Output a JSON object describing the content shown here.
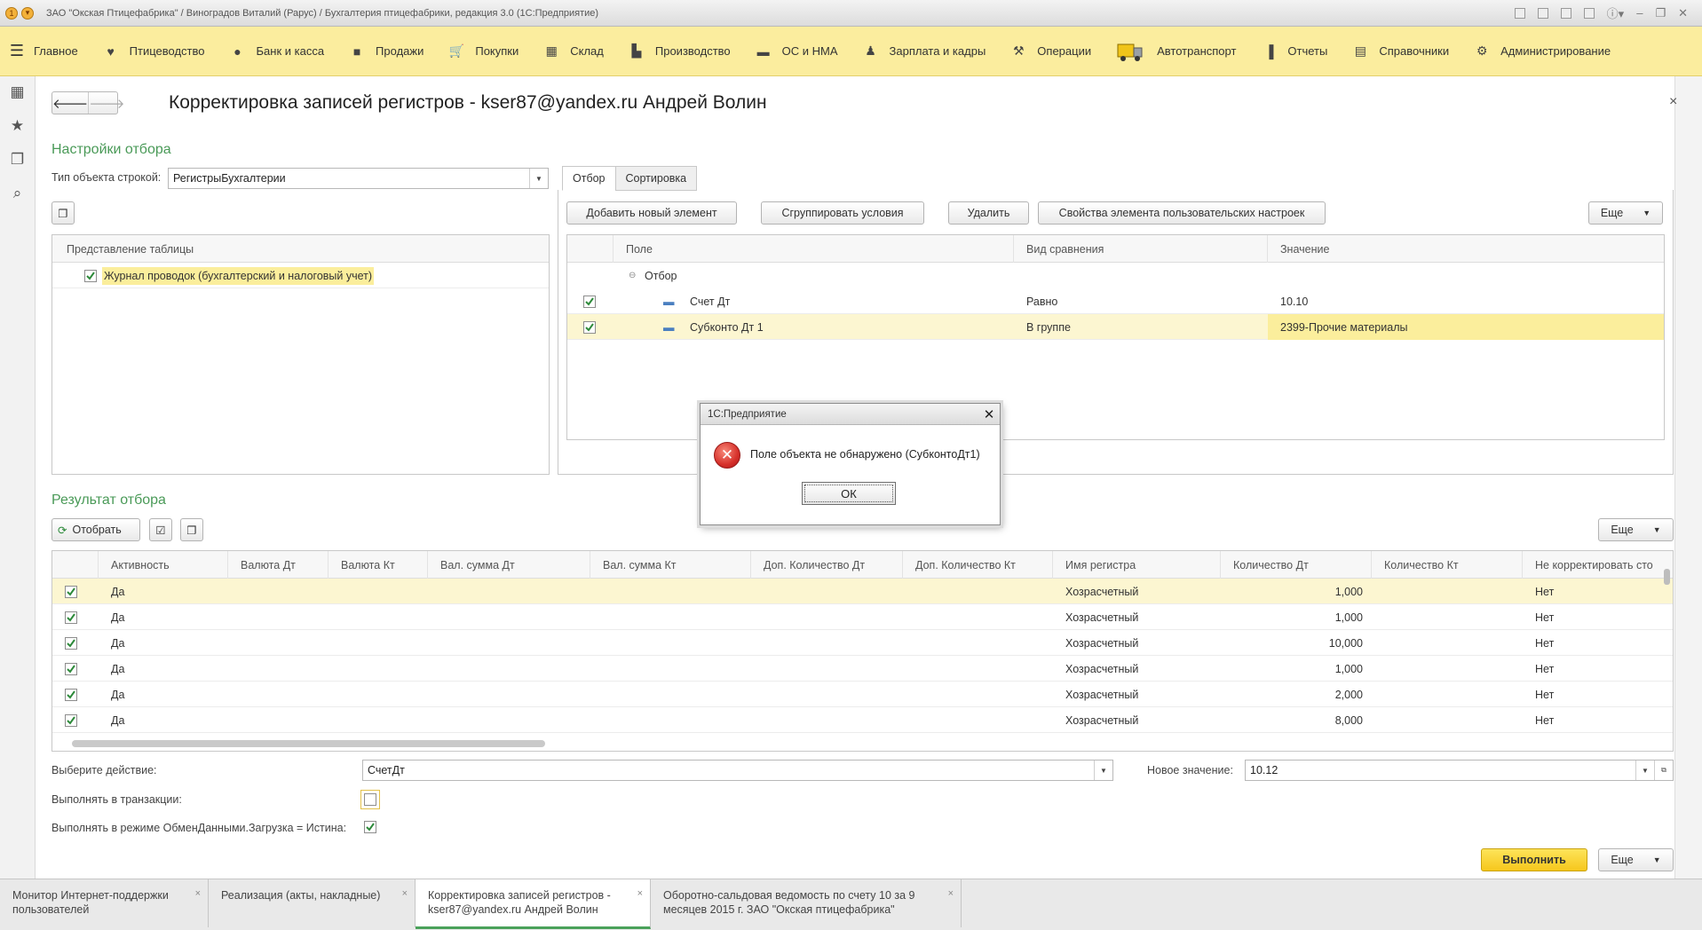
{
  "window": {
    "title": "ЗАО \"Окская Птицефабрика\" / Виноградов Виталий (Рарус) / Бухгалтерия птицефабрики, редакция 3.0  (1С:Предприятие)"
  },
  "menu": [
    {
      "label": "Главное",
      "icon": "burger-icon"
    },
    {
      "label": "Птицеводство",
      "icon": "bird-icon"
    },
    {
      "label": "Банк и касса",
      "icon": "coin-icon"
    },
    {
      "label": "Продажи",
      "icon": "bag-icon"
    },
    {
      "label": "Покупки",
      "icon": "cart-icon"
    },
    {
      "label": "Склад",
      "icon": "grid-icon"
    },
    {
      "label": "Производство",
      "icon": "factory-icon"
    },
    {
      "label": "ОС и НМА",
      "icon": "truck-small-icon"
    },
    {
      "label": "Зарплата и кадры",
      "icon": "person-icon"
    },
    {
      "label": "Операции",
      "icon": "operations-icon"
    },
    {
      "label": "Автотранспорт",
      "icon": "truck-icon"
    },
    {
      "label": "Отчеты",
      "icon": "chart-icon"
    },
    {
      "label": "Справочники",
      "icon": "book-icon"
    },
    {
      "label": "Администрирование",
      "icon": "gear-icon"
    }
  ],
  "form": {
    "title": "Корректировка записей регистров - kser87@yandex.ru Андрей Волин",
    "close": "×"
  },
  "filter_settings": {
    "section_title": "Настройки отбора",
    "object_type_label": "Тип объекта строкой:",
    "object_type_value": "РегистрыБухгалтерии",
    "table_header": "Представление таблицы",
    "table_rows": [
      {
        "checked": true,
        "label": "Журнал проводок (бухгалтерский и налоговый учет)"
      }
    ]
  },
  "tabs": [
    {
      "label": "Отбор",
      "active": true
    },
    {
      "label": "Сортировка",
      "active": false
    }
  ],
  "filter_toolbar": {
    "add": "Добавить новый элемент",
    "group": "Сгруппировать условия",
    "delete": "Удалить",
    "properties": "Свойства элемента пользовательских настроек",
    "more": "Еще"
  },
  "filter_table": {
    "columns": [
      "Поле",
      "Вид сравнения",
      "Значение"
    ],
    "group_label": "Отбор",
    "rows": [
      {
        "checked": true,
        "field": "Счет Дт",
        "comparison": "Равно",
        "value": "10.10"
      },
      {
        "checked": true,
        "field": "Субконто Дт 1",
        "comparison": "В группе",
        "value": "2399-Прочие материалы"
      }
    ]
  },
  "dialog": {
    "title": "1С:Предприятие",
    "message": "Поле объекта не обнаружено (СубконтоДт1)",
    "ok": "ОК"
  },
  "result": {
    "section_title": "Результат отбора",
    "select_button": "Отобрать",
    "more": "Еще",
    "columns": [
      "Активность",
      "Валюта Дт",
      "Валюта Кт",
      "Вал. сумма Дт",
      "Вал. сумма Кт",
      "Доп. Количество Дт",
      "Доп. Количество Кт",
      "Имя регистра",
      "Количество Дт",
      "Количество Кт",
      "Не корректировать сто"
    ],
    "rows": [
      {
        "checked": true,
        "active": "Да",
        "register": "Хозрасчетный",
        "qty_dt": "1,000",
        "no_adjust": "Нет"
      },
      {
        "checked": true,
        "active": "Да",
        "register": "Хозрасчетный",
        "qty_dt": "1,000",
        "no_adjust": "Нет"
      },
      {
        "checked": true,
        "active": "Да",
        "register": "Хозрасчетный",
        "qty_dt": "10,000",
        "no_adjust": "Нет"
      },
      {
        "checked": true,
        "active": "Да",
        "register": "Хозрасчетный",
        "qty_dt": "1,000",
        "no_adjust": "Нет"
      },
      {
        "checked": true,
        "active": "Да",
        "register": "Хозрасчетный",
        "qty_dt": "2,000",
        "no_adjust": "Нет"
      },
      {
        "checked": true,
        "active": "Да",
        "register": "Хозрасчетный",
        "qty_dt": "8,000",
        "no_adjust": "Нет"
      }
    ]
  },
  "action": {
    "label": "Выберите действие:",
    "value": "СчетДт",
    "new_value_label": "Новое значение:",
    "new_value": "10.12",
    "transaction_label": "Выполнять в транзакции:",
    "transaction_checked": false,
    "exchange_label": "Выполнять в режиме ОбменДанными.Загрузка = Истина:",
    "exchange_checked": true,
    "execute": "Выполнить",
    "more": "Еще"
  },
  "window_tabs": [
    {
      "label": "Монитор Интернет-поддержки пользователей",
      "active": false
    },
    {
      "label": "Реализация (акты, накладные)",
      "active": false
    },
    {
      "label": "Корректировка записей регистров - kser87@yandex.ru Андрей Волин",
      "active": true
    },
    {
      "label": "Оборотно-сальдовая ведомость по счету 10 за 9 месяцев 2015 г. ЗАО \"Окская птицефабрика\"",
      "active": false
    }
  ],
  "colors": {
    "menu_bg": "#fbed9e",
    "section_title": "#4a9a58",
    "row_highlight": "#fcf6d1",
    "primary_button": "#f6c71c"
  }
}
